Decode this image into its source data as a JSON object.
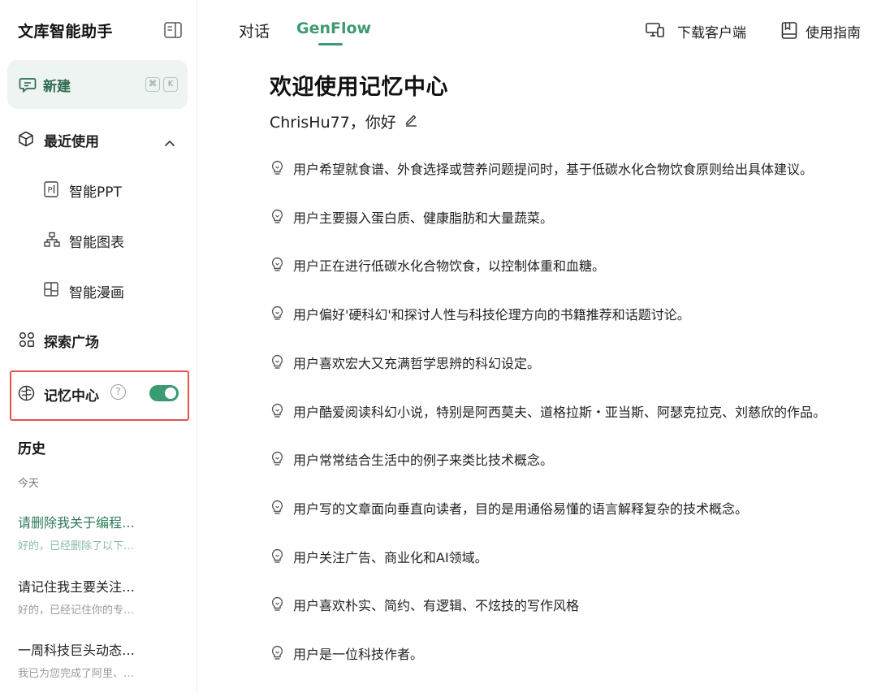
{
  "app": {
    "title": "文库智能助手"
  },
  "new_chat": {
    "label": "新建",
    "shortcut": [
      "⌘",
      "K"
    ]
  },
  "recent": {
    "label": "最近使用",
    "items": [
      {
        "label": "智能PPT",
        "icon": "ppt-icon"
      },
      {
        "label": "智能图表",
        "icon": "chart-icon"
      },
      {
        "label": "智能漫画",
        "icon": "comic-icon"
      }
    ]
  },
  "explore": {
    "label": "探索广场"
  },
  "memory": {
    "label": "记忆中心",
    "help": "?",
    "enabled": true
  },
  "history": {
    "title": "历史",
    "group": "今天",
    "items": [
      {
        "title": "请删除我关于编程…",
        "snippet": "好的，已经删除了以下…"
      },
      {
        "title": "请记住我主要关注…",
        "snippet": "好的，已经记住你的专…"
      },
      {
        "title": "一周科技巨头动态…",
        "snippet": "我已为您完成了阿里、…"
      }
    ]
  },
  "tabs": [
    {
      "label": "对话"
    },
    {
      "label": "GenFlow"
    }
  ],
  "header": {
    "download": "下载客户端",
    "guide": "使用指南"
  },
  "main": {
    "title": "欢迎使用记忆中心",
    "greeting": "ChrisHu77，你好",
    "memories": [
      "用户希望就食谱、外食选择或营养问题提问时，基于低碳水化合物饮食原则给出具体建议。",
      "用户主要摄入蛋白质、健康脂肪和大量蔬菜。",
      "用户正在进行低碳水化合物饮食，以控制体重和血糖。",
      "用户偏好'硬科幻'和探讨人性与科技伦理方向的书籍推荐和话题讨论。",
      "用户喜欢宏大又充满哲学思辨的科幻设定。",
      "用户酷爱阅读科幻小说，特别是阿西莫夫、道格拉斯・亚当斯、阿瑟克拉克、刘慈欣的作品。",
      "用户常常结合生活中的例子来类比技术概念。",
      "用户写的文章面向垂直向读者，目的是用通俗易懂的语言解释复杂的技术概念。",
      "用户关注广告、商业化和AI领域。",
      "用户喜欢朴实、简约、有逻辑、不炫技的写作风格",
      "用户是一位科技作者。"
    ]
  },
  "colors": {
    "accent": "#3f9a74",
    "highlight_border": "#e5534b",
    "new_bg": "#eef4f1"
  }
}
